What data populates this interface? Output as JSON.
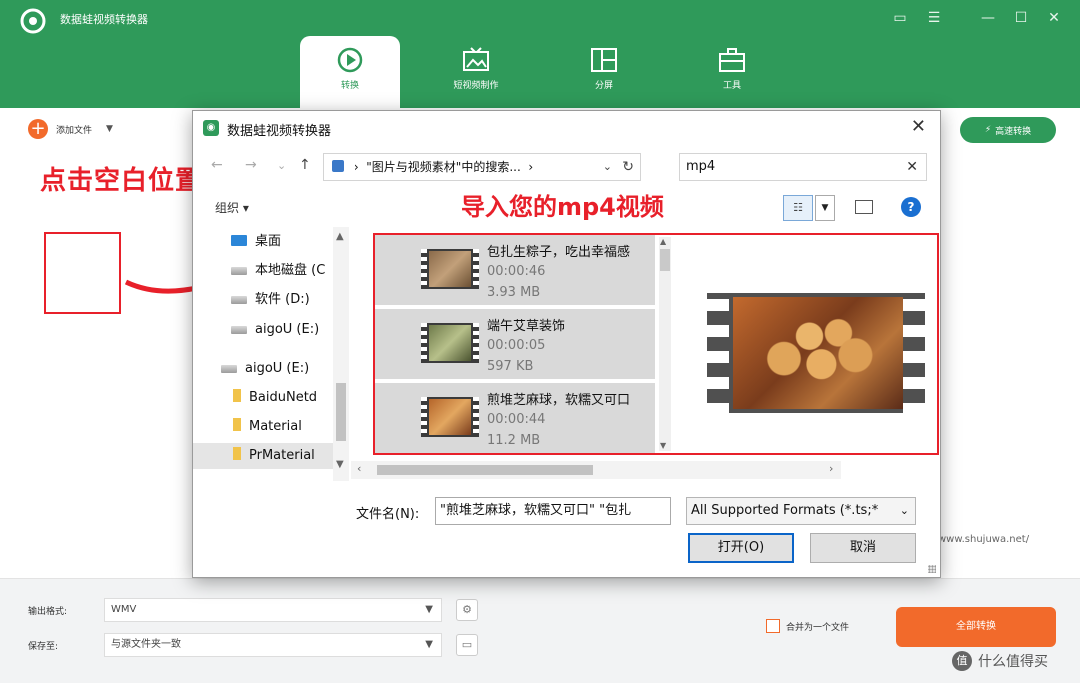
{
  "app": {
    "title": "数据蛙视频转换器",
    "tabs": [
      {
        "label": "转换",
        "icon": "convert-icon",
        "active": true
      },
      {
        "label": "短视频制作",
        "icon": "video-maker-icon",
        "active": false
      },
      {
        "label": "分屏",
        "icon": "split-screen-icon",
        "active": false
      },
      {
        "label": "工具",
        "icon": "toolbox-icon",
        "active": false
      }
    ],
    "window_controls": [
      "feedback-icon",
      "menu-icon",
      "minimize-icon",
      "maximize-icon",
      "close-icon"
    ],
    "accent_color": "#2f9a5a",
    "orange_color": "#f26a2b"
  },
  "main": {
    "add_file_label": "添加文件",
    "hs_convert_label": "高速转换",
    "watermark": "www.shujuwa.net/"
  },
  "annotations": {
    "click_blank": "点击空白位置",
    "import_mp4": "导入您的mp4视频",
    "color": "#e8202a"
  },
  "bottom": {
    "output_format_label": "输出格式:",
    "output_format_value": "WMV",
    "save_to_label": "保存至:",
    "save_to_value": "与源文件夹一致",
    "merge_label": "合并为一个文件",
    "merge_checked": false,
    "convert_all_label": "全部转换",
    "corner_text": "什么值得买",
    "corner_icon_text": "值"
  },
  "dialog": {
    "title": "数据蛙视频转换器",
    "address": "\"图片与视频素材\"中的搜索...",
    "search_value": "mp4",
    "organize_label": "组织 ▾",
    "nav_items": [
      {
        "label": "桌面",
        "icon": "desktop-icon",
        "selected": false
      },
      {
        "label": "本地磁盘 (C",
        "icon": "drive-icon",
        "selected": false
      },
      {
        "label": "软件 (D:)",
        "icon": "drive-icon",
        "selected": false
      },
      {
        "label": "aigoU (E:)",
        "icon": "drive-icon",
        "selected": false
      },
      {
        "label": "aigoU (E:)",
        "icon": "drive-icon",
        "selected": false
      },
      {
        "label": "BaiduNetd",
        "icon": "folder-icon",
        "selected": false
      },
      {
        "label": "Material",
        "icon": "folder-icon",
        "selected": false
      },
      {
        "label": "PrMaterial",
        "icon": "folder-icon",
        "selected": true
      }
    ],
    "files": [
      {
        "name": "包扎生粽子，吃出幸福感",
        "duration": "00:00:46",
        "size": "3.93 MB"
      },
      {
        "name": "端午艾草装饰",
        "duration": "00:00:05",
        "size": "597 KB"
      },
      {
        "name": "煎堆芝麻球，软糯又可口",
        "duration": "00:00:44",
        "size": "11.2 MB"
      }
    ],
    "filename_label": "文件名(N):",
    "filename_value": "\"煎堆芝麻球，软糯又可口\" \"包扎",
    "filter_value": "All Supported Formats (*.ts;*",
    "open_label": "打开(O)",
    "cancel_label": "取消"
  }
}
